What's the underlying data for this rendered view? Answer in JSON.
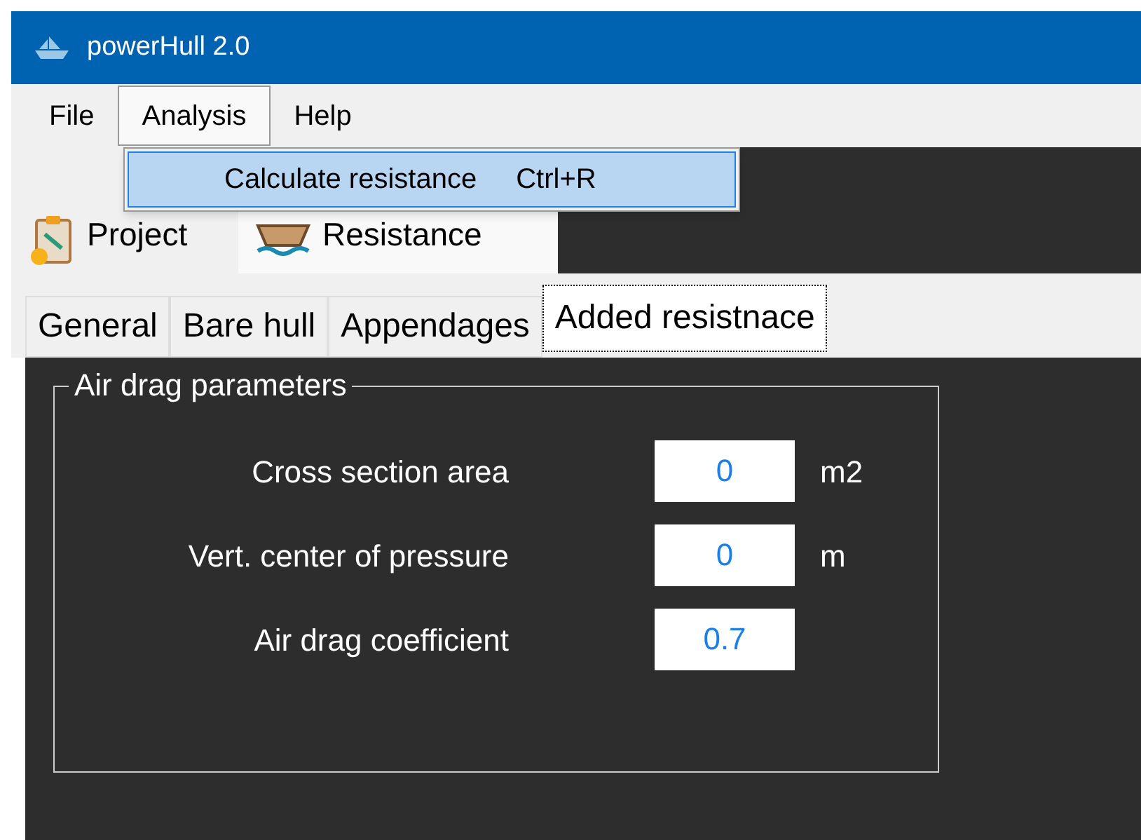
{
  "window": {
    "title": "powerHull 2.0"
  },
  "menu": [
    {
      "label": "File",
      "selected": false
    },
    {
      "label": "Analysis",
      "selected": true
    },
    {
      "label": "Help",
      "selected": false
    }
  ],
  "dropdown": {
    "items": [
      {
        "label": "Calculate resistance",
        "shortcut": "Ctrl+R",
        "selected": true
      }
    ]
  },
  "main_tabs": [
    {
      "label": "Project",
      "selected": false,
      "kind": "project"
    },
    {
      "label": "Resistance",
      "selected": true,
      "kind": "resistance"
    }
  ],
  "sub_tabs": [
    {
      "label": "General",
      "selected": false
    },
    {
      "label": "Bare hull",
      "selected": false
    },
    {
      "label": "Appendages",
      "selected": false
    },
    {
      "label": "Added resistnace",
      "selected": true
    }
  ],
  "group": {
    "title": "Air drag parameters",
    "fields": [
      {
        "label": "Cross section area",
        "value": "0",
        "unit": "m2"
      },
      {
        "label": "Vert. center of pressure",
        "value": "0",
        "unit": "m"
      },
      {
        "label": "Air drag coefficient",
        "value": "0.7"
      }
    ]
  }
}
